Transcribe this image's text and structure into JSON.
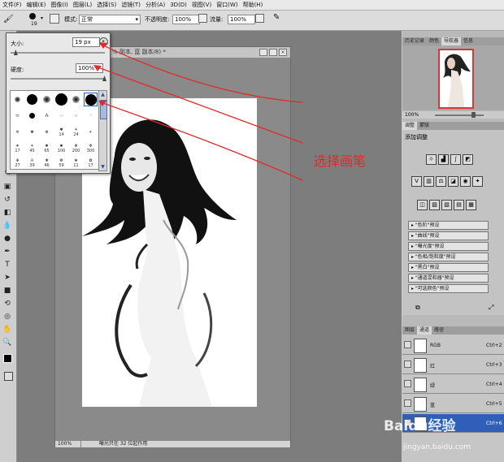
{
  "menu": [
    "文件(F)",
    "编辑(E)",
    "图像(I)",
    "图层(L)",
    "选择(S)",
    "滤镜(T)",
    "分析(A)",
    "3D(D)",
    "视图(V)",
    "窗口(W)",
    "帮助(H)"
  ],
  "options": {
    "brush_size_small": "19",
    "mode_label": "模式:",
    "mode_value": "正常",
    "opacity_label": "不透明度:",
    "opacity_value": "100%",
    "flow_label": "流量:",
    "flow_value": "100%"
  },
  "brush_popup": {
    "size_label": "大小:",
    "size_value": "19 px",
    "hardness_label": "硬度:",
    "hardness_value": "100%",
    "size_fraction": 0.05,
    "hardness_fraction": 1.0,
    "presets_row4": [
      "17",
      "45",
      "65",
      "100",
      "200",
      "300"
    ],
    "presets_row3": [
      "",
      "",
      "",
      "14",
      "24",
      ""
    ],
    "presets_row5": [
      "27",
      "39",
      "46",
      "59",
      "11",
      "17"
    ]
  },
  "document": {
    "title": "% 副本, 蓝 副本/8) *",
    "zoom": "100%",
    "status": "曝光只在 32 位起作用"
  },
  "navigator": {
    "tabs": [
      "历史记录",
      "颜色",
      "导航器",
      "信息"
    ],
    "zoom": "100%"
  },
  "adjustments": {
    "tabs": [
      "调整",
      "蒙版"
    ],
    "heading": "添加调整",
    "presets": [
      "\"色阶\"预设",
      "\"曲线\"预设",
      "\"曝光度\"预设",
      "\"色相/饱和度\"预设",
      "\"黑白\"预设",
      "\"通道混和器\"预设",
      "\"可选颜色\"预设"
    ]
  },
  "channels": {
    "tabs": [
      "图层",
      "通道",
      "路径"
    ],
    "rows": [
      {
        "name": "RGB",
        "key": "Ctrl+2"
      },
      {
        "name": "红",
        "key": "Ctrl+3"
      },
      {
        "name": "绿",
        "key": "Ctrl+4"
      },
      {
        "name": "蓝",
        "key": "Ctrl+5"
      },
      {
        "name": "",
        "key": "Ctrl+6"
      }
    ]
  },
  "annotation": "选择画笔",
  "watermark": {
    "brand": "Baidu经验",
    "url": "jingyan.baidu.com"
  },
  "colors": {
    "annotation_red": "#e02a2a",
    "selected_row": "#2f5fb8"
  }
}
